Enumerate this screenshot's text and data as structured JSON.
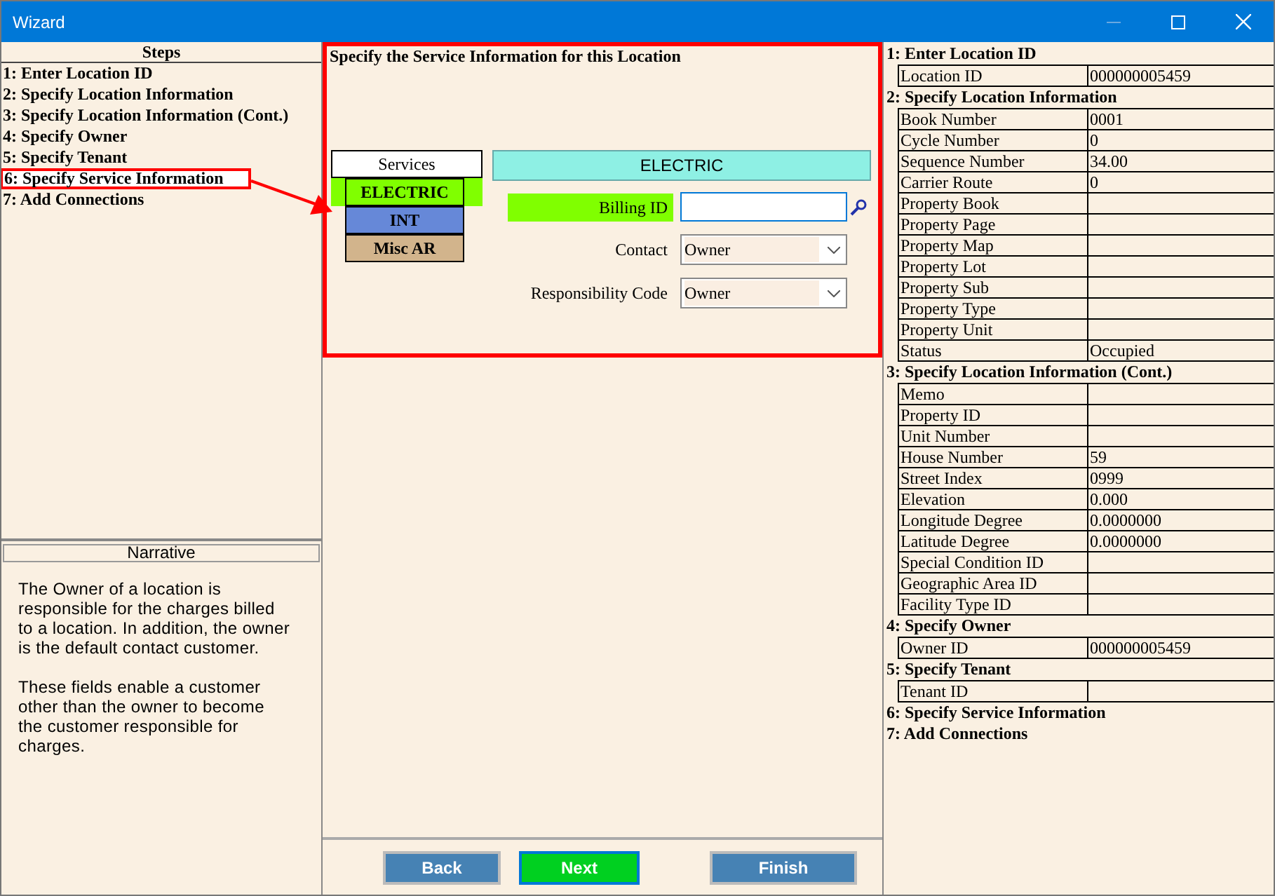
{
  "window": {
    "title": "Wizard"
  },
  "steps": {
    "title": "Steps",
    "items": [
      {
        "label": "1: Enter Location ID",
        "selected": false
      },
      {
        "label": "2: Specify Location Information",
        "selected": false
      },
      {
        "label": "3: Specify Location Information (Cont.)",
        "selected": false
      },
      {
        "label": "4: Specify Owner",
        "selected": false
      },
      {
        "label": "5: Specify Tenant",
        "selected": false
      },
      {
        "label": "6: Specify Service Information",
        "selected": true
      },
      {
        "label": "7: Add Connections",
        "selected": false
      }
    ]
  },
  "narrative": {
    "title": "Narrative",
    "paragraphs": [
      "The Owner of a location is responsible for the charges billed to a location. In addition, the owner is the default contact customer.",
      "These fields enable a customer other than the owner to become the customer responsible for charges."
    ]
  },
  "form": {
    "title": "Specify the Service Information for this Location",
    "services": {
      "header": "Services",
      "items": [
        {
          "label": "ELECTRIC",
          "color": "#80ff00",
          "selected": true
        },
        {
          "label": "INT",
          "color": "#6688d8",
          "selected": false
        },
        {
          "label": "Misc AR",
          "color": "#d2b48c",
          "selected": false
        }
      ]
    },
    "service_header": "ELECTRIC",
    "fields": [
      {
        "kind": "input",
        "label": "Billing ID",
        "highlighted": true
      },
      {
        "kind": "select",
        "label": "Contact",
        "value": "Owner",
        "highlighted": false
      },
      {
        "kind": "select",
        "label": "Responsibility Code",
        "value": "Owner",
        "highlighted": false
      }
    ]
  },
  "buttons": [
    {
      "label": "Back",
      "primary": false
    },
    {
      "label": "Next",
      "primary": true
    },
    {
      "label": "Finish",
      "primary": false
    }
  ],
  "summary": [
    {
      "title": "1: Enter Location ID",
      "rows": [
        {
          "label": "Location ID",
          "value": "000000005459"
        }
      ]
    },
    {
      "title": "2: Specify Location Information",
      "rows": [
        {
          "label": "Book Number",
          "value": "0001"
        },
        {
          "label": "Cycle Number",
          "value": "0"
        },
        {
          "label": "Sequence Number",
          "value": "34.00"
        },
        {
          "label": "Carrier Route",
          "value": "0"
        },
        {
          "label": "Property Book"
        },
        {
          "label": "Property Page"
        },
        {
          "label": "Property Map"
        },
        {
          "label": "Property Lot"
        },
        {
          "label": "Property Sub"
        },
        {
          "label": "Property Type"
        },
        {
          "label": "Property Unit"
        },
        {
          "label": "Status",
          "value": "Occupied"
        }
      ]
    },
    {
      "title": "3: Specify Location Information (Cont.)",
      "rows": [
        {
          "label": "Memo"
        },
        {
          "label": "Property ID"
        },
        {
          "label": "Unit Number"
        },
        {
          "label": "House Number",
          "value": "59"
        },
        {
          "label": "Street Index",
          "value": "0999"
        },
        {
          "label": "Elevation",
          "value": "0.000"
        },
        {
          "label": "Longitude Degree",
          "value": "0.0000000"
        },
        {
          "label": "Latitude Degree",
          "value": "0.0000000"
        },
        {
          "label": "Special Condition ID"
        },
        {
          "label": "Geographic Area ID"
        },
        {
          "label": "Facility Type ID"
        }
      ]
    },
    {
      "title": "4: Specify Owner",
      "rows": [
        {
          "label": "Owner  ID",
          "value": "000000005459"
        }
      ]
    },
    {
      "title": "5: Specify Tenant",
      "rows": [
        {
          "label": "Tenant  ID"
        }
      ]
    },
    {
      "title": "6: Specify Service Information"
    },
    {
      "title": "7: Add Connections"
    }
  ]
}
